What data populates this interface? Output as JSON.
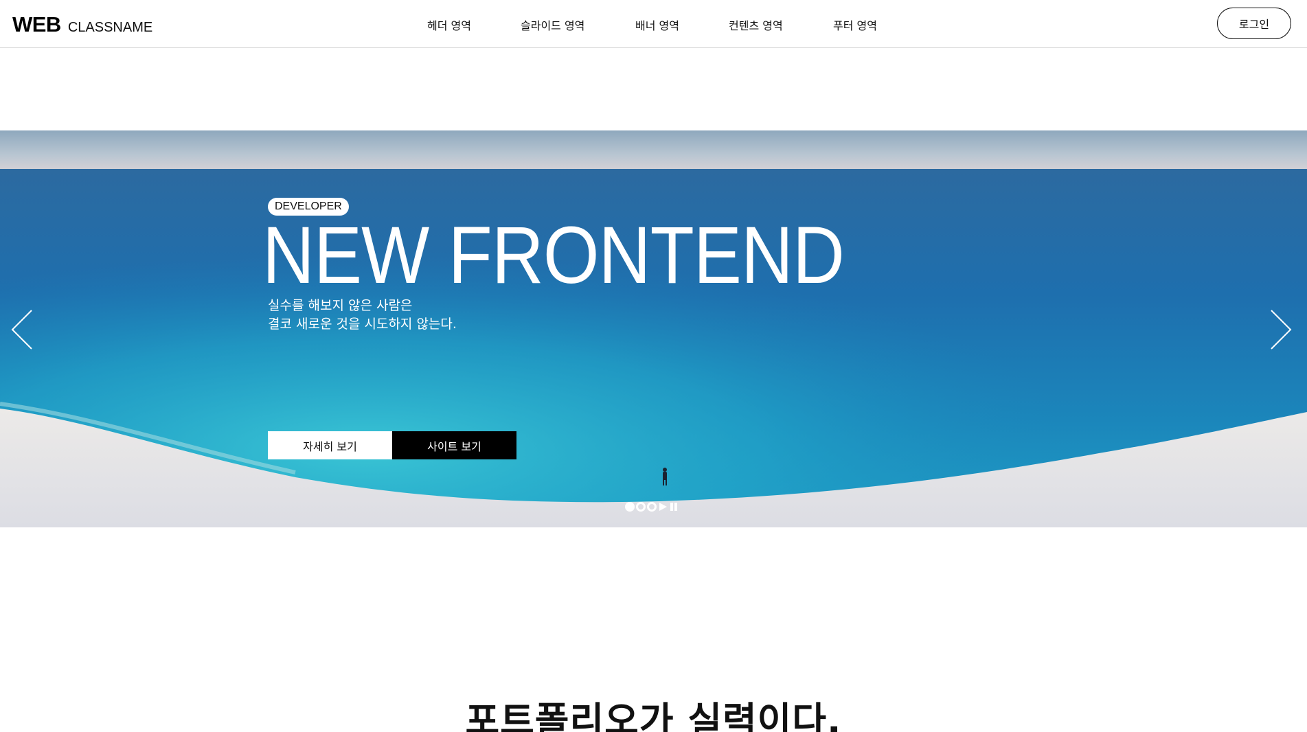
{
  "header": {
    "logo_main": "WEB",
    "logo_sub": "CLASSNAME",
    "nav": [
      {
        "label": "헤더 영역"
      },
      {
        "label": "슬라이드 영역"
      },
      {
        "label": "배너 영역"
      },
      {
        "label": "컨텐츠 영역"
      },
      {
        "label": "푸터 영역"
      }
    ],
    "login_label": "로그인"
  },
  "slider": {
    "badge": "DEVELOPER",
    "headline": "NEW FRONTEND",
    "desc_line1": "실수를 해보지 않은 사람은",
    "desc_line2": "결코 새로운 것을 시도하지 않는다.",
    "btn_detail": "자세히 보기",
    "btn_site": "사이트 보기",
    "pager": {
      "current": 1,
      "total": 3,
      "controls": [
        "play-icon",
        "pause-icon"
      ]
    },
    "arrows": [
      "chevron-left-icon",
      "chevron-right-icon"
    ]
  },
  "section": {
    "title": "포트폴리오가 실력이다."
  },
  "colors": {
    "text": "#111111",
    "header_border": "#d9d9d9",
    "button_dark": "#000000",
    "button_light": "#ffffff",
    "sea_deep": "#1a5f9c",
    "sea_shallow": "#21a8c4",
    "sand": "#e8e9ee"
  }
}
